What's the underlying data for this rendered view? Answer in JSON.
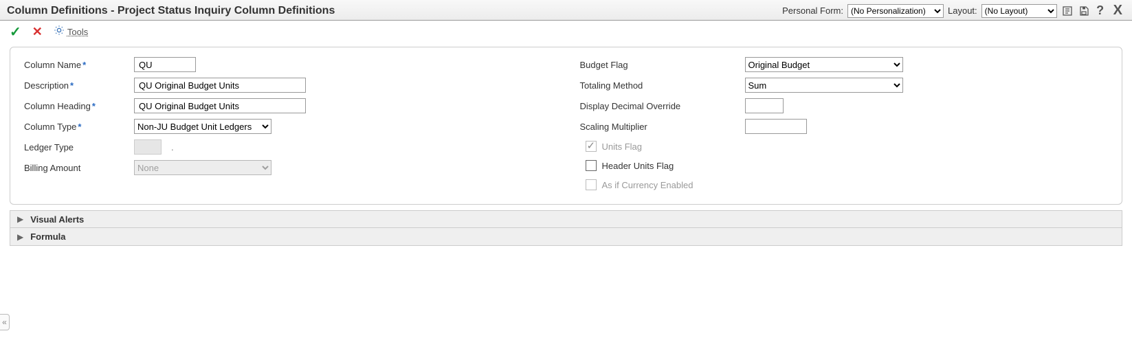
{
  "header": {
    "title": "Column Definitions - Project Status Inquiry Column Definitions",
    "personal_form_label": "Personal Form:",
    "personal_form_value": "(No Personalization)",
    "layout_label": "Layout:",
    "layout_value": "(No Layout)"
  },
  "toolbar": {
    "tools_label": "Tools"
  },
  "form": {
    "left": {
      "column_name_label": "Column Name",
      "column_name_value": "QU",
      "description_label": "Description",
      "description_value": "QU Original Budget Units",
      "column_heading_label": "Column Heading",
      "column_heading_value": "QU Original Budget Units",
      "column_type_label": "Column Type",
      "column_type_value": "Non-JU Budget Unit Ledgers",
      "ledger_type_label": "Ledger Type",
      "ledger_type_value": "",
      "billing_amount_label": "Billing Amount",
      "billing_amount_value": "None"
    },
    "right": {
      "budget_flag_label": "Budget Flag",
      "budget_flag_value": "Original Budget",
      "totaling_method_label": "Totaling Method",
      "totaling_method_value": "Sum",
      "display_decimal_override_label": "Display Decimal Override",
      "display_decimal_override_value": "",
      "scaling_multiplier_label": "Scaling Multiplier",
      "scaling_multiplier_value": "",
      "units_flag_label": "Units Flag",
      "units_flag_checked": true,
      "units_flag_enabled": false,
      "header_units_flag_label": "Header Units Flag",
      "header_units_flag_checked": false,
      "as_if_currency_label": "As if Currency Enabled",
      "as_if_currency_checked": false,
      "as_if_currency_enabled": false
    }
  },
  "sections": {
    "visual_alerts": "Visual Alerts",
    "formula": "Formula"
  }
}
